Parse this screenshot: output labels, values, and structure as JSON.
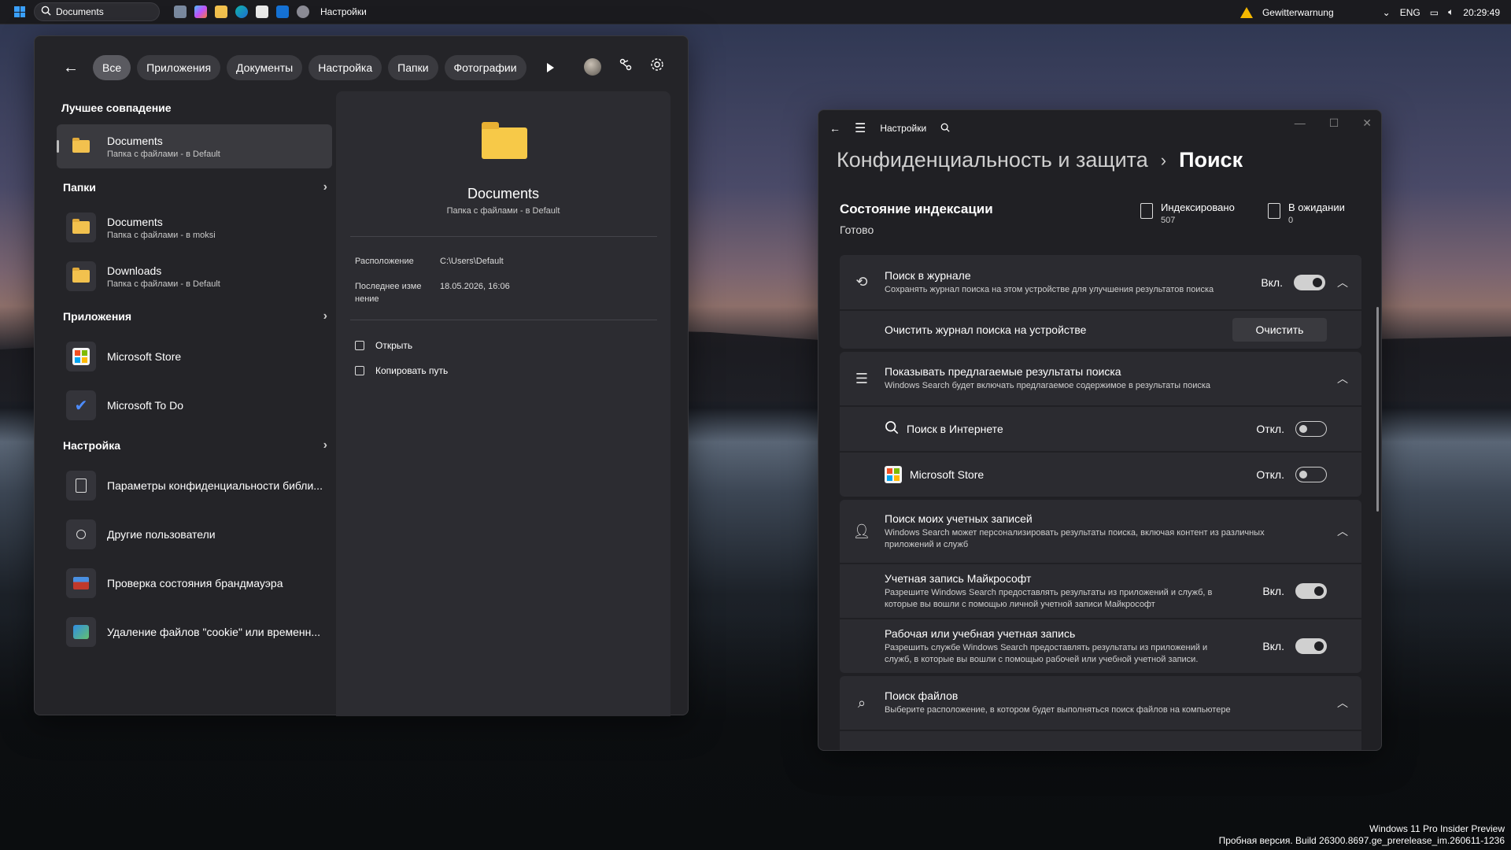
{
  "taskbar": {
    "search_value": "Documents",
    "settings_app_label": "Настройки",
    "weather_alert": "Gewitterwarnung",
    "language": "ENG",
    "clock": "20:29:49",
    "apps": [
      "task-view-icon",
      "copilot-icon",
      "file-explorer-icon",
      "edge-icon",
      "store-icon",
      "outlook-icon",
      "settings-icon"
    ]
  },
  "search_panel": {
    "filters": [
      "Все",
      "Приложения",
      "Документы",
      "Настройка",
      "Папки",
      "Фотографии"
    ],
    "best_match_heading": "Лучшее совпадение",
    "best_match": {
      "title": "Documents",
      "subtitle": "Папка с файлами - в Default"
    },
    "folders_heading": "Папки",
    "folders": [
      {
        "title": "Documents",
        "subtitle": "Папка с файлами - в moksi"
      },
      {
        "title": "Downloads",
        "subtitle": "Папка с файлами - в Default"
      }
    ],
    "apps_heading": "Приложения",
    "apps": [
      {
        "title": "Microsoft Store"
      },
      {
        "title": "Microsoft To Do"
      }
    ],
    "settings_heading": "Настройка",
    "settings": [
      {
        "title": "Параметры конфиденциальности библи..."
      },
      {
        "title": "Другие пользователи"
      },
      {
        "title": "Проверка состояния брандмауэра"
      },
      {
        "title": "Удаление файлов \"cookie\" или временн..."
      }
    ],
    "preview": {
      "title": "Documents",
      "subtitle": "Папка с файлами - в Default",
      "location_label": "Расположение",
      "location_value": "C:\\Users\\Default",
      "modified_label_1": "Последнее изме",
      "modified_label_2": "нение",
      "modified_value": "18.05.2026, 16:06",
      "action_open": "Открыть",
      "action_copy_path": "Копировать путь"
    }
  },
  "settings_window": {
    "title": "Настройки",
    "breadcrumb_parent": "Конфиденциальность и защита",
    "breadcrumb_sep": "›",
    "breadcrumb_current": "Поиск",
    "indexing": {
      "title": "Состояние индексации",
      "status": "Готово",
      "indexed_label": "Индексировано",
      "indexed_value": "507",
      "pending_label": "В ожидании",
      "pending_value": "0"
    },
    "history": {
      "title": "Поиск в журнале",
      "desc": "Сохранять журнал поиска на этом устройстве для улучшения результатов поиска",
      "state": "Вкл.",
      "clear_label": "Очистить журнал поиска на устройстве",
      "clear_button": "Очистить"
    },
    "suggested": {
      "title": "Показывать предлагаемые результаты поиска",
      "desc": "Windows Search будет включать предлагаемое содержимое в результаты поиска",
      "web_label": "Поиск в Интернете",
      "web_state": "Откл.",
      "store_label": "Microsoft Store",
      "store_state": "Откл."
    },
    "accounts": {
      "title": "Поиск моих учетных записей",
      "desc_1": "Windows Search может персонализировать результаты поиска, включая контент из различных",
      "desc_2": "приложений и служб",
      "ms_title": "Учетная запись Майкрософт",
      "ms_desc_1": "Разрешите Windows Search предоставлять результаты из приложений и служб, в",
      "ms_desc_2": "которые вы вошли с помощью личной учетной записи Майкрософт",
      "ms_state": "Вкл.",
      "work_title": "Рабочая или учебная учетная запись",
      "work_desc_1": "Разрешить службе Windows Search предоставлять результаты из приложений и",
      "work_desc_2": "служб, в которые вы вошли с помощью рабочей или учебной учетной записи.",
      "work_state": "Вкл."
    },
    "files": {
      "title": "Поиск файлов",
      "desc": "Выберите расположение, в котором будет выполняться поиск файлов на компьютере"
    }
  },
  "watermark": {
    "line1": "Windows 11 Pro Insider Preview",
    "line2": "Пробная версия. Build 26300.8697.ge_prerelease_im.260611-1236"
  }
}
